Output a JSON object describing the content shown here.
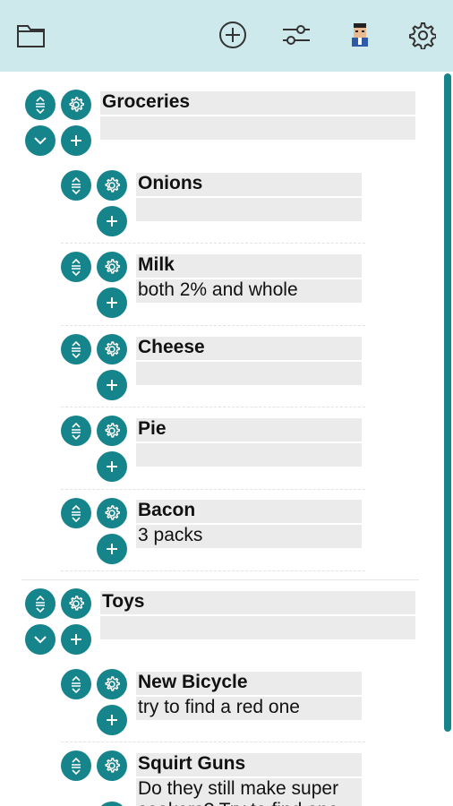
{
  "toolbar": {
    "icons": [
      "folder-icon",
      "add-circle-icon",
      "sliders-icon",
      "avatar",
      "gear-icon"
    ]
  },
  "lists": [
    {
      "title": "Groceries",
      "note": "",
      "items": [
        {
          "title": "Onions",
          "note": ""
        },
        {
          "title": "Milk",
          "note": "both 2% and whole"
        },
        {
          "title": "Cheese",
          "note": ""
        },
        {
          "title": "Pie",
          "note": ""
        },
        {
          "title": "Bacon",
          "note": "3 packs"
        }
      ]
    },
    {
      "title": "Toys",
      "note": "",
      "items": [
        {
          "title": "New Bicycle",
          "note": "try to find a red one"
        },
        {
          "title": "Squirt Guns",
          "note": "Do they still make super\nsoakers? Try to find one"
        }
      ]
    }
  ],
  "colors": {
    "accent": "#15848b",
    "toolbar_bg": "#cde9ec",
    "field_bg": "#ebebeb"
  }
}
